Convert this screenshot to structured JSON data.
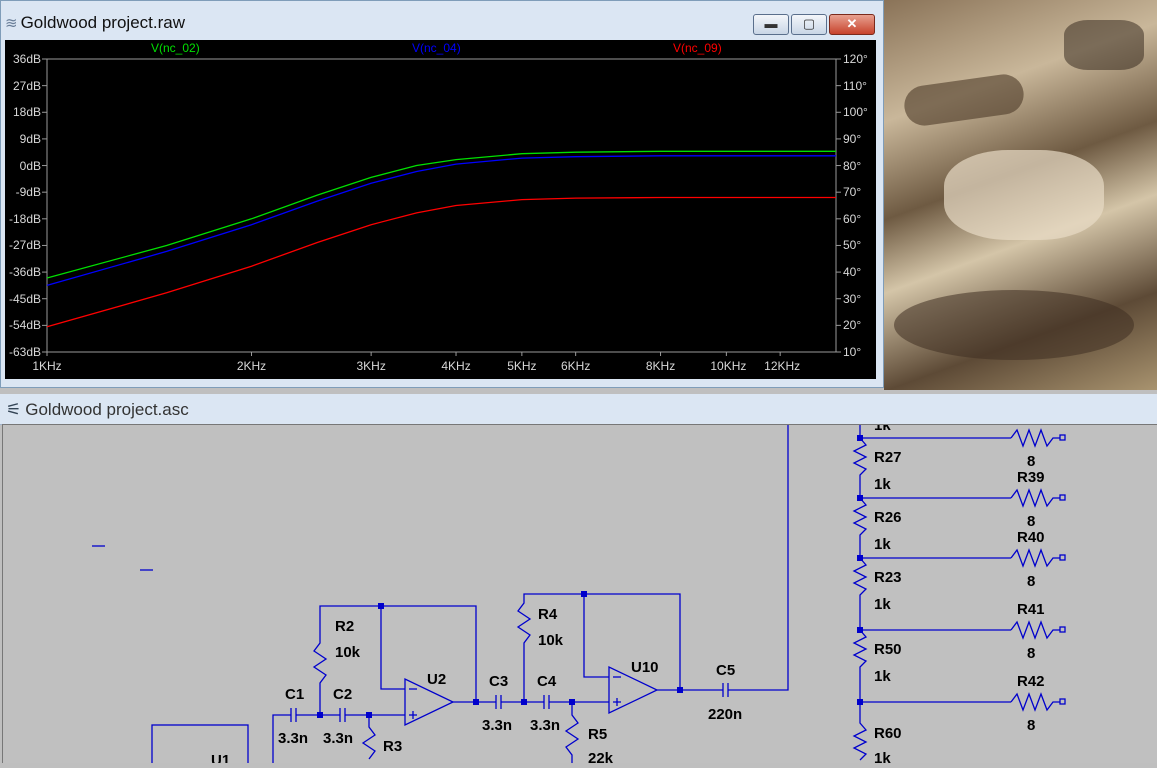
{
  "raw_window": {
    "title": "Goldwood project.raw",
    "traces": [
      {
        "name": "V(nc_02)",
        "color": "#00e000"
      },
      {
        "name": "V(nc_04)",
        "color": "#0000ff"
      },
      {
        "name": "V(nc_09)",
        "color": "#ff0000"
      }
    ],
    "y_left_ticks": [
      "36dB",
      "27dB",
      "18dB",
      "9dB",
      "0dB",
      "-9dB",
      "-18dB",
      "-27dB",
      "-36dB",
      "-45dB",
      "-54dB",
      "-63dB"
    ],
    "y_right_ticks": [
      "120°",
      "110°",
      "100°",
      "90°",
      "80°",
      "70°",
      "60°",
      "50°",
      "40°",
      "30°",
      "20°",
      "10°"
    ],
    "x_ticks": [
      {
        "label": "1KHz",
        "f": 1000
      },
      {
        "label": "2KHz",
        "f": 2000
      },
      {
        "label": "3KHz",
        "f": 3000
      },
      {
        "label": "4KHz",
        "f": 4000
      },
      {
        "label": "5KHz",
        "f": 5000
      },
      {
        "label": "6KHz",
        "f": 6000
      },
      {
        "label": "8KHz",
        "f": 8000
      },
      {
        "label": "10KHz",
        "f": 10000
      },
      {
        "label": "12KHz",
        "f": 12000
      }
    ]
  },
  "chart_data": {
    "type": "line",
    "xlabel": "",
    "ylabel": "",
    "x_scale": "log",
    "xlim": [
      1000,
      14500
    ],
    "ylim": [
      -63,
      36
    ],
    "y2lim": [
      10,
      120
    ],
    "grid": false,
    "x": [
      1000,
      1500,
      2000,
      2500,
      3000,
      3500,
      4000,
      5000,
      6000,
      8000,
      10000,
      14500
    ],
    "series": [
      {
        "name": "V(nc_02)",
        "color": "#00e000",
        "values": [
          -38,
          -27,
          -18,
          -10,
          -4,
          0,
          2,
          4,
          4.5,
          4.8,
          4.8,
          4.8
        ]
      },
      {
        "name": "V(nc_04)",
        "color": "#0000ff",
        "values": [
          -40.5,
          -29,
          -20,
          -12,
          -6,
          -2,
          0.5,
          2.5,
          3,
          3.3,
          3.3,
          3.3
        ]
      },
      {
        "name": "V(nc_09)",
        "color": "#ff0000",
        "values": [
          -54.5,
          -43,
          -34,
          -26,
          -20,
          -16,
          -13.5,
          -11.5,
          -11,
          -10.8,
          -10.8,
          -10.8
        ]
      }
    ]
  },
  "asc_window": {
    "title": "Goldwood project.asc"
  },
  "schematic": {
    "labels": {
      "C1": "C1",
      "C1v": "3.3n",
      "C2": "C2",
      "C2v": "3.3n",
      "R2": "R2",
      "R2v": "10k",
      "R3": "R3",
      "U1": "U1",
      "U2": "U2",
      "C3": "C3",
      "C3v": "3.3n",
      "C4": "C4",
      "C4v": "3.3n",
      "R4": "R4",
      "R4v": "10k",
      "R5": "R5",
      "R5v": "22k",
      "U10": "U10",
      "C5": "C5",
      "C5v": "220n",
      "R27": "R27",
      "R27v": "1k",
      "R26": "R26",
      "R26v": "1k",
      "R23": "R23",
      "R23v": "1k",
      "R50": "R50",
      "R50v": "1k",
      "R60": "R60",
      "R60v": "1k",
      "Rtop": "1k",
      "R39": "R39",
      "R39v": "8",
      "R40": "R40",
      "R40v": "8",
      "R41": "R41",
      "R41v": "8",
      "R42": "R42",
      "R42v": "8",
      "Rtopv": "8"
    }
  }
}
